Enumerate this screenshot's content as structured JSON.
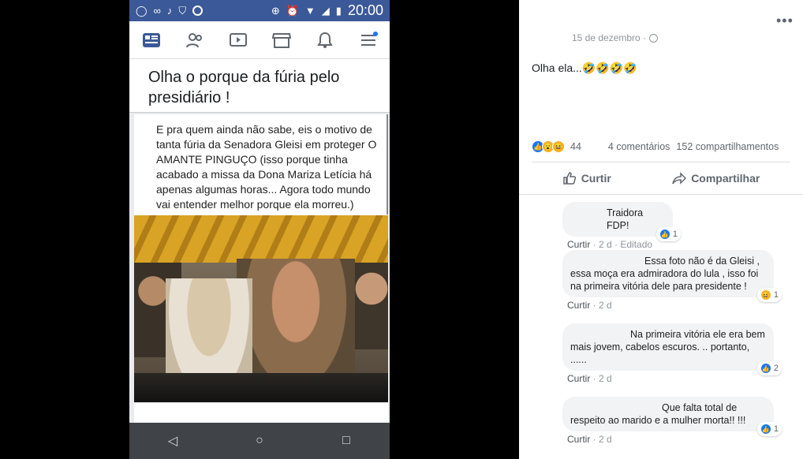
{
  "phone": {
    "status_time": "20:00",
    "title": "Olha o porque da fúria pelo presidiário !",
    "caption": "E pra quem ainda não sabe, eis o motivo de tanta fúria da Senadora Gleisi em proteger O AMANTE PINGUÇO (isso porque tinha acabado a missa da Dona Mariza Letícia há apenas algumas horas... Agora todo mundo vai entender melhor porque ela morreu.)"
  },
  "post": {
    "date": "15 de dezembro ·",
    "text": "Olha ela...🤣🤣🤣🤣",
    "reaction_count": "44",
    "comments": "4 comentários",
    "shares": "152 compartilhamentos",
    "like_label": "Curtir",
    "share_label": "Compartilhar"
  },
  "comments": [
    {
      "text": "Traidora FDP!",
      "reply": "Curtir",
      "time": "2 d",
      "extra": "· Editado",
      "reactions": "1"
    },
    {
      "text": "Essa foto não é da Gleisi , essa moça era admiradora do lula , isso foi na primeira vitória dele para presidente !",
      "reply": "Curtir",
      "time": "2 d",
      "reactions": "1"
    },
    {
      "text": "Na primeira vitória ele era bem mais jovem, cabelos escuros. .. portanto, ......",
      "reply": "Curtir",
      "time": "2 d",
      "reactions": "2"
    },
    {
      "text": "Que falta total de respeito ao marido e a mulher morta!! !!!",
      "reply": "Curtir",
      "time": "2 d",
      "reactions": "1"
    }
  ],
  "colors": {
    "facebook_blue": "#3b5998",
    "like_blue": "#1877f2"
  }
}
